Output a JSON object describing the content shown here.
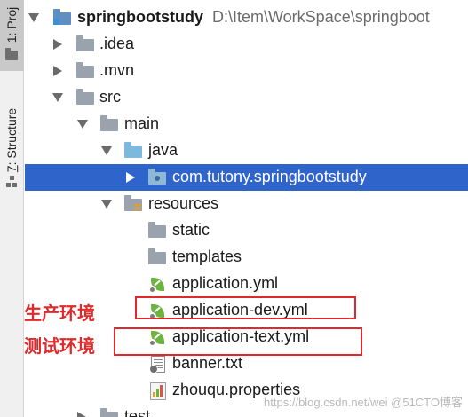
{
  "side_panel": {
    "project_tab": {
      "number": "1",
      "label": ": Project",
      "visible_label": "1: Proj"
    },
    "structure_tab": {
      "number": "7",
      "label": ": Structure"
    }
  },
  "tree": {
    "root": {
      "name": "springbootstudy",
      "path": "D:\\Item\\WorkSpace\\springboot"
    },
    "items": [
      {
        "label": ".idea",
        "icon": "folder-icon"
      },
      {
        "label": ".mvn",
        "icon": "folder-icon"
      },
      {
        "label": "src",
        "icon": "folder-icon"
      },
      {
        "label": "main",
        "icon": "folder-icon"
      },
      {
        "label": "java",
        "icon": "source-folder-icon"
      },
      {
        "label": "com.tutony.springbootstudy",
        "icon": "package-icon",
        "selected": true
      },
      {
        "label": "resources",
        "icon": "resources-folder-icon"
      },
      {
        "label": "static",
        "icon": "folder-icon"
      },
      {
        "label": "templates",
        "icon": "folder-icon"
      },
      {
        "label": "application.yml",
        "icon": "spring-yml-icon"
      },
      {
        "label": "application-dev.yml",
        "icon": "spring-yml-icon"
      },
      {
        "label": "application-text.yml",
        "icon": "spring-yml-icon"
      },
      {
        "label": "banner.txt",
        "icon": "text-file-icon"
      },
      {
        "label": "zhouqu.properties",
        "icon": "properties-file-icon"
      },
      {
        "label": "test",
        "icon": "folder-icon"
      }
    ]
  },
  "annotations": {
    "dev": {
      "text": "生产环境"
    },
    "test": {
      "text": "测试环境"
    }
  },
  "watermark": "https://blog.csdn.net/wei @51CTO博客",
  "colors": {
    "selection": "#2f65ca",
    "annotation": "#e0292b",
    "spring_green": "#6db33f"
  }
}
